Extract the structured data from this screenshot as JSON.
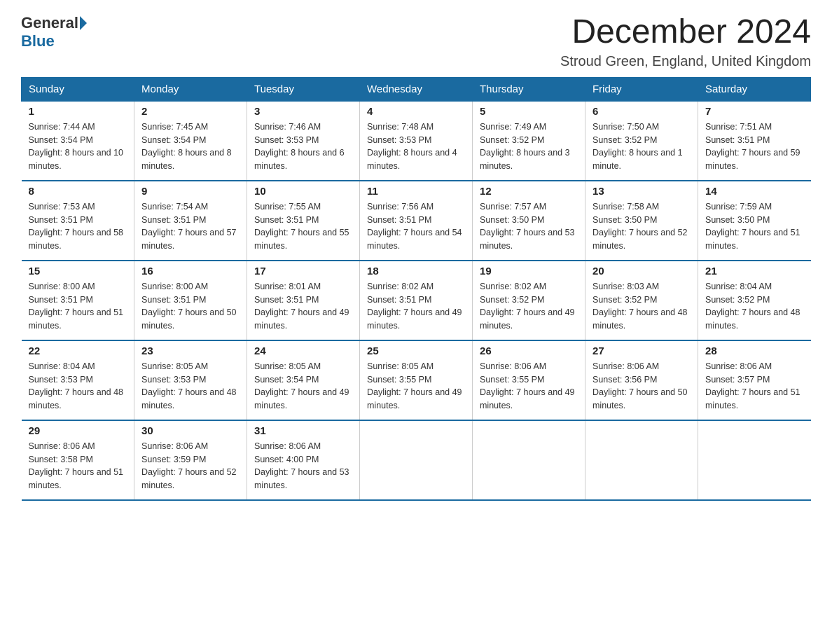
{
  "logo": {
    "general": "General",
    "blue": "Blue"
  },
  "title": "December 2024",
  "location": "Stroud Green, England, United Kingdom",
  "days_of_week": [
    "Sunday",
    "Monday",
    "Tuesday",
    "Wednesday",
    "Thursday",
    "Friday",
    "Saturday"
  ],
  "weeks": [
    [
      {
        "day": "1",
        "sunrise": "7:44 AM",
        "sunset": "3:54 PM",
        "daylight": "8 hours and 10 minutes."
      },
      {
        "day": "2",
        "sunrise": "7:45 AM",
        "sunset": "3:54 PM",
        "daylight": "8 hours and 8 minutes."
      },
      {
        "day": "3",
        "sunrise": "7:46 AM",
        "sunset": "3:53 PM",
        "daylight": "8 hours and 6 minutes."
      },
      {
        "day": "4",
        "sunrise": "7:48 AM",
        "sunset": "3:53 PM",
        "daylight": "8 hours and 4 minutes."
      },
      {
        "day": "5",
        "sunrise": "7:49 AM",
        "sunset": "3:52 PM",
        "daylight": "8 hours and 3 minutes."
      },
      {
        "day": "6",
        "sunrise": "7:50 AM",
        "sunset": "3:52 PM",
        "daylight": "8 hours and 1 minute."
      },
      {
        "day": "7",
        "sunrise": "7:51 AM",
        "sunset": "3:51 PM",
        "daylight": "7 hours and 59 minutes."
      }
    ],
    [
      {
        "day": "8",
        "sunrise": "7:53 AM",
        "sunset": "3:51 PM",
        "daylight": "7 hours and 58 minutes."
      },
      {
        "day": "9",
        "sunrise": "7:54 AM",
        "sunset": "3:51 PM",
        "daylight": "7 hours and 57 minutes."
      },
      {
        "day": "10",
        "sunrise": "7:55 AM",
        "sunset": "3:51 PM",
        "daylight": "7 hours and 55 minutes."
      },
      {
        "day": "11",
        "sunrise": "7:56 AM",
        "sunset": "3:51 PM",
        "daylight": "7 hours and 54 minutes."
      },
      {
        "day": "12",
        "sunrise": "7:57 AM",
        "sunset": "3:50 PM",
        "daylight": "7 hours and 53 minutes."
      },
      {
        "day": "13",
        "sunrise": "7:58 AM",
        "sunset": "3:50 PM",
        "daylight": "7 hours and 52 minutes."
      },
      {
        "day": "14",
        "sunrise": "7:59 AM",
        "sunset": "3:50 PM",
        "daylight": "7 hours and 51 minutes."
      }
    ],
    [
      {
        "day": "15",
        "sunrise": "8:00 AM",
        "sunset": "3:51 PM",
        "daylight": "7 hours and 51 minutes."
      },
      {
        "day": "16",
        "sunrise": "8:00 AM",
        "sunset": "3:51 PM",
        "daylight": "7 hours and 50 minutes."
      },
      {
        "day": "17",
        "sunrise": "8:01 AM",
        "sunset": "3:51 PM",
        "daylight": "7 hours and 49 minutes."
      },
      {
        "day": "18",
        "sunrise": "8:02 AM",
        "sunset": "3:51 PM",
        "daylight": "7 hours and 49 minutes."
      },
      {
        "day": "19",
        "sunrise": "8:02 AM",
        "sunset": "3:52 PM",
        "daylight": "7 hours and 49 minutes."
      },
      {
        "day": "20",
        "sunrise": "8:03 AM",
        "sunset": "3:52 PM",
        "daylight": "7 hours and 48 minutes."
      },
      {
        "day": "21",
        "sunrise": "8:04 AM",
        "sunset": "3:52 PM",
        "daylight": "7 hours and 48 minutes."
      }
    ],
    [
      {
        "day": "22",
        "sunrise": "8:04 AM",
        "sunset": "3:53 PM",
        "daylight": "7 hours and 48 minutes."
      },
      {
        "day": "23",
        "sunrise": "8:05 AM",
        "sunset": "3:53 PM",
        "daylight": "7 hours and 48 minutes."
      },
      {
        "day": "24",
        "sunrise": "8:05 AM",
        "sunset": "3:54 PM",
        "daylight": "7 hours and 49 minutes."
      },
      {
        "day": "25",
        "sunrise": "8:05 AM",
        "sunset": "3:55 PM",
        "daylight": "7 hours and 49 minutes."
      },
      {
        "day": "26",
        "sunrise": "8:06 AM",
        "sunset": "3:55 PM",
        "daylight": "7 hours and 49 minutes."
      },
      {
        "day": "27",
        "sunrise": "8:06 AM",
        "sunset": "3:56 PM",
        "daylight": "7 hours and 50 minutes."
      },
      {
        "day": "28",
        "sunrise": "8:06 AM",
        "sunset": "3:57 PM",
        "daylight": "7 hours and 51 minutes."
      }
    ],
    [
      {
        "day": "29",
        "sunrise": "8:06 AM",
        "sunset": "3:58 PM",
        "daylight": "7 hours and 51 minutes."
      },
      {
        "day": "30",
        "sunrise": "8:06 AM",
        "sunset": "3:59 PM",
        "daylight": "7 hours and 52 minutes."
      },
      {
        "day": "31",
        "sunrise": "8:06 AM",
        "sunset": "4:00 PM",
        "daylight": "7 hours and 53 minutes."
      },
      null,
      null,
      null,
      null
    ]
  ]
}
